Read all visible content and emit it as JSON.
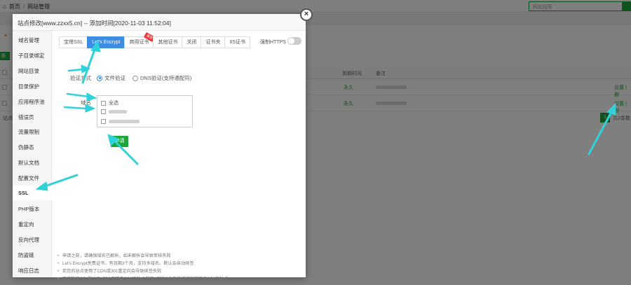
{
  "background": {
    "breadcrumb": [
      "首页",
      "网站管理"
    ],
    "search_placeholder": "网站搜索",
    "add_label": "添",
    "columns": {
      "expire": "到期时间",
      "remark": "备注"
    },
    "rows": [
      {
        "expire": "永久",
        "actions": "设置 | 删"
      },
      {
        "expire": "永久",
        "actions": "设置 | 删"
      }
    ],
    "pagination": {
      "current": "1",
      "total": "共2条数"
    },
    "site_label": "站点"
  },
  "modal": {
    "title": "站点修改[www.zzxx5.cn] -- 添加时间[2020-11-03 11:52:04]",
    "close_glyph": "×",
    "sidebar": [
      "域名管理",
      "子目录绑定",
      "网站目录",
      "目录保护",
      "应用程序池",
      "错误页",
      "流量限制",
      "伪静态",
      "默认文档",
      "配置文件",
      "SSL",
      "PHP版本",
      "重定向",
      "反向代理",
      "防盗链",
      "响应日志"
    ],
    "active_sidebar_index": 10,
    "tabs": [
      {
        "label": "宝塔SSL",
        "active": false
      },
      {
        "label": "Let's Encrypt",
        "active": true
      },
      {
        "label": "商用证书",
        "active": false,
        "badge": "推荐"
      },
      {
        "label": "其他证书",
        "active": false
      },
      {
        "label": "关闭",
        "active": false
      },
      {
        "label": "证书夹",
        "active": false
      },
      {
        "label": "IIS证书",
        "active": false
      }
    ],
    "force_https": {
      "label": "强制HTTPS",
      "enabled": false
    },
    "verify": {
      "label": "验证方式",
      "options": [
        {
          "label": "文件验证",
          "selected": true
        },
        {
          "label": "DNS验证(支持通配符)",
          "selected": false
        }
      ]
    },
    "domain": {
      "label": "域名",
      "select_all": "全选"
    },
    "apply_label": "申请",
    "notes": [
      "申请之前，请确保域名已解析，如未解析会导致审核失败",
      "Let's Encrypt免费证书，有效期3个月，支持多域名。默认会自动续签",
      "若您的站点使用了CDN或301重定向会导致续签失败",
      "在未指定SSL默认站点时,未开启SSL的站点使用HTTPS会直接访问到已开启SSL的站点"
    ]
  },
  "colors": {
    "accent_green": "#20a53a",
    "tab_blue": "#3d8ce4",
    "arrow_cyan": "#2ed2d8"
  }
}
